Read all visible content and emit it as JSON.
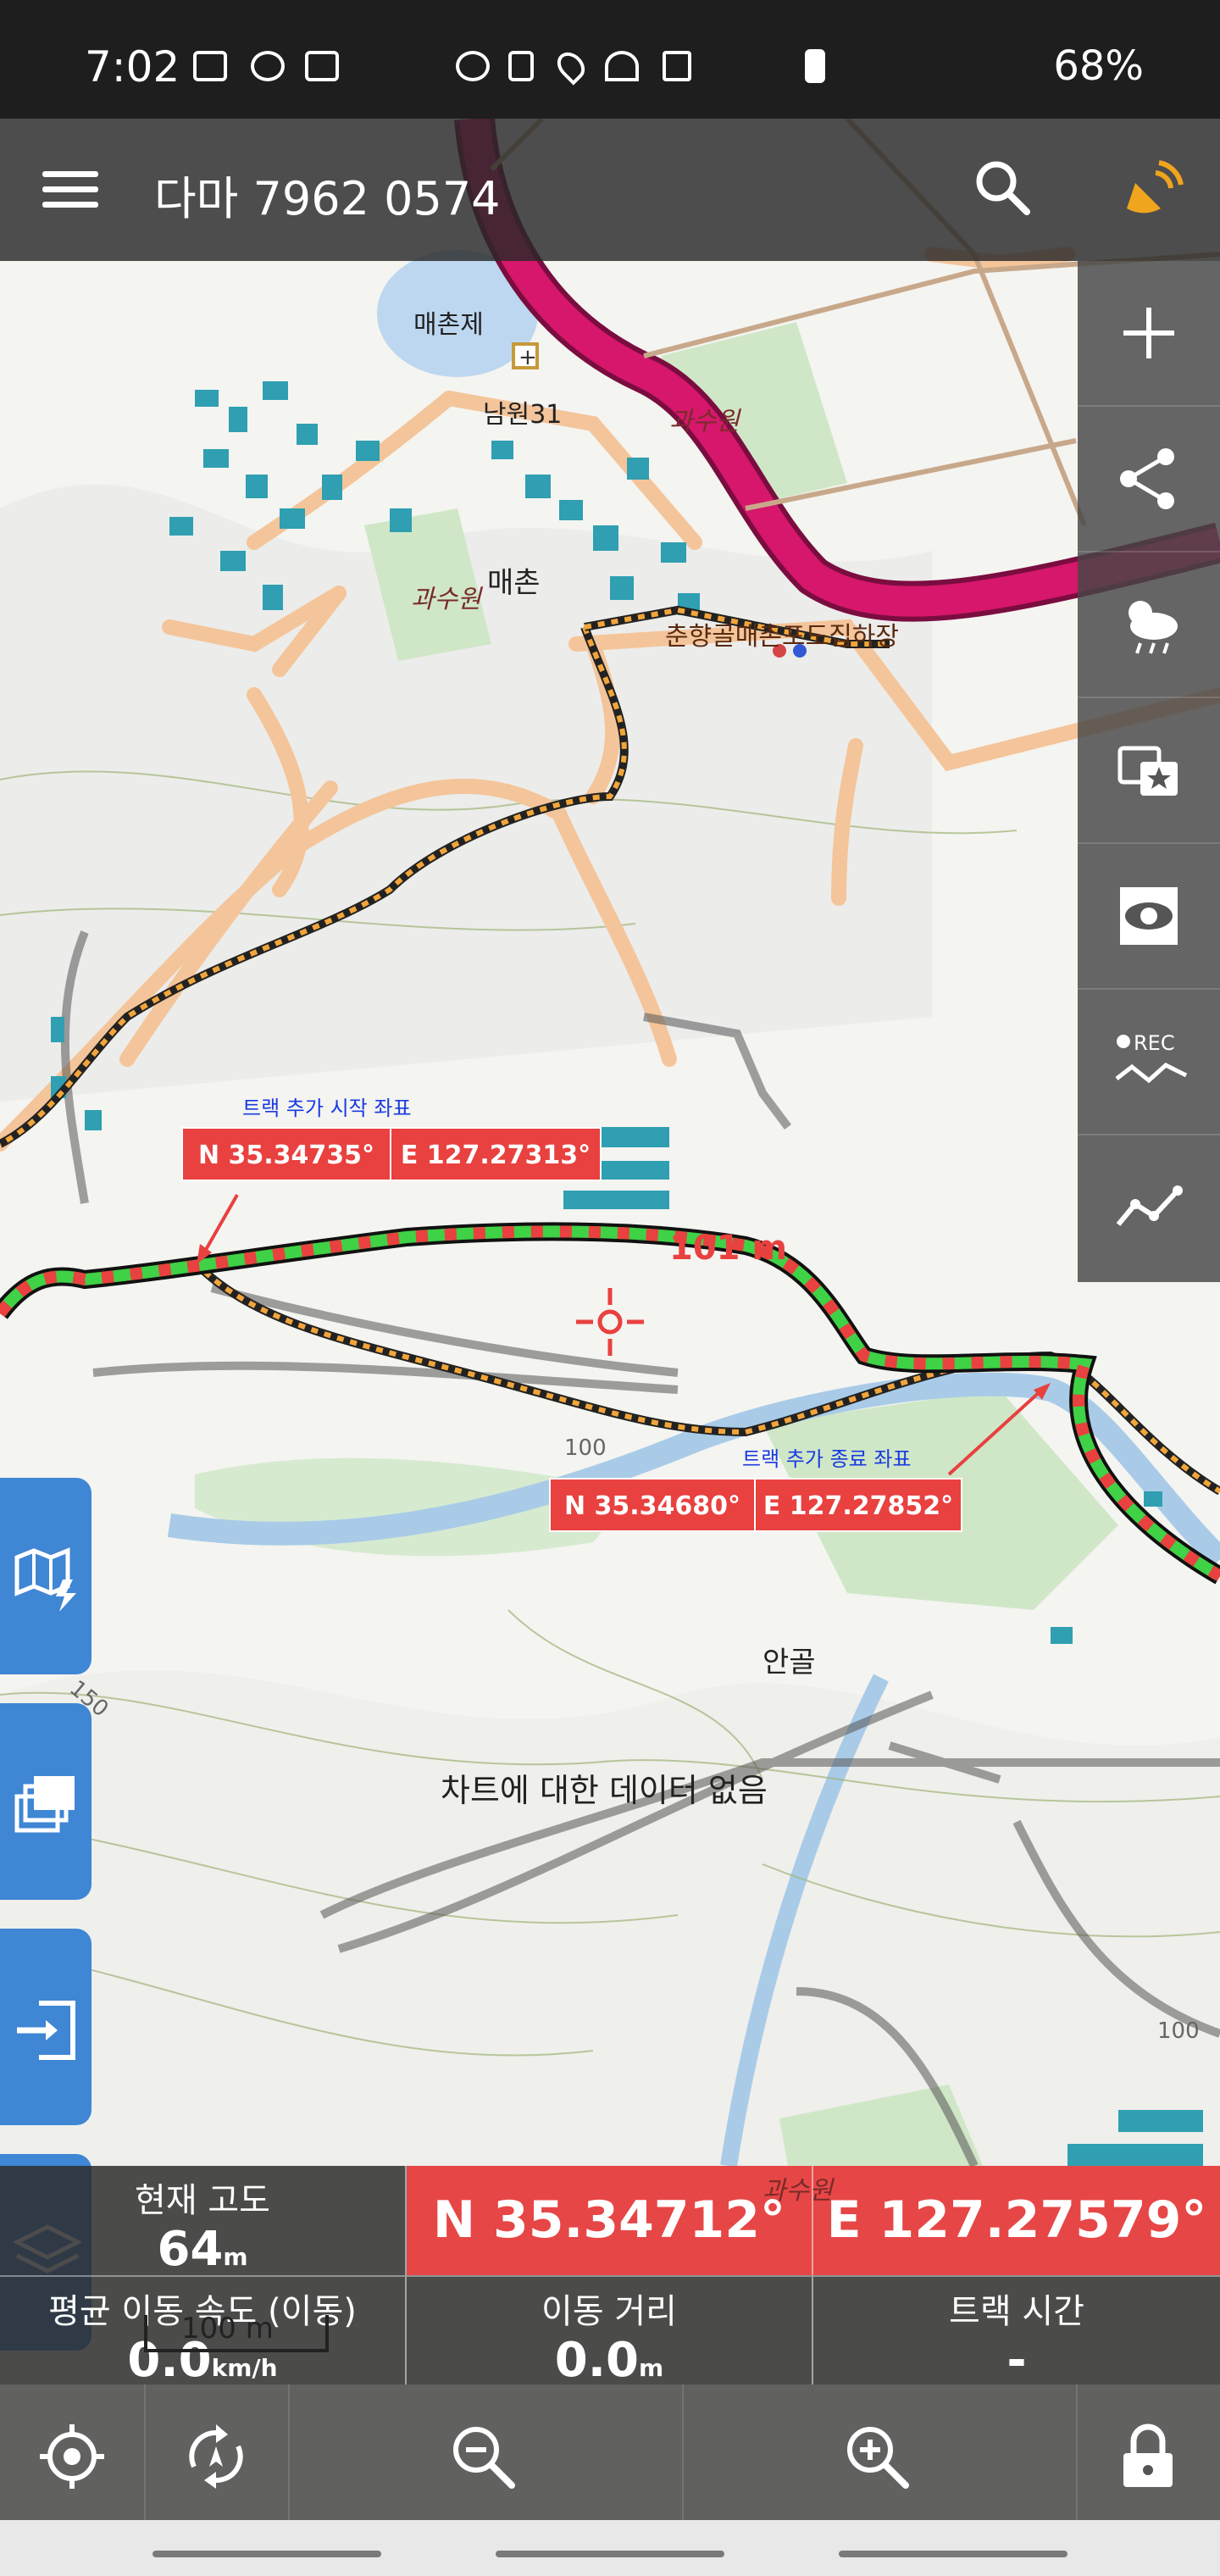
{
  "status_bar": {
    "time": "7:02",
    "battery": "68%"
  },
  "top_bar": {
    "title": "다마 7962 0574"
  },
  "map": {
    "place_labels": {
      "reservoir": "매촌제",
      "bus_stop": "남원31",
      "orchard_1": "과수원",
      "orchard_2": "과수원",
      "village": "매촌",
      "facility": "춘향골매촌포도집하장",
      "valley": "안골",
      "orchard_3": "과수원"
    },
    "contour_labels": {
      "c100a": "100",
      "c150": "150",
      "c100b": "100"
    },
    "track_start": {
      "caption": "트랙 추가 시작 좌표",
      "lat": "N 35.34735°",
      "lon": "E 127.27313°"
    },
    "track_end": {
      "caption": "트랙 추가 종료 좌표",
      "lat": "N 35.34680°",
      "lon": "E 127.27852°"
    },
    "distance_label": "101 m",
    "no_data": "차트에 대한 데이터 없음",
    "scale_bar": "100 m"
  },
  "info_panel": {
    "altitude_label": "현재 고도",
    "altitude_value": "64",
    "altitude_unit": "m",
    "lat": "N 35.34712°",
    "lon": "E 127.27579°",
    "speed_label": "평균 이동 속도 (이동)",
    "speed_value": "0.0",
    "speed_unit": "km/h",
    "distance_label": "이동 거리",
    "distance_value": "0.0",
    "distance_unit": "m",
    "track_time_label": "트랙 시간",
    "track_time_value": "-"
  },
  "icons": {
    "right_toolbar": [
      "plus-icon",
      "share-icon",
      "weather-icon",
      "favorite-icon",
      "visibility-icon",
      "rec-track-icon",
      "chart-icon"
    ],
    "left_buttons": [
      "map-mode-icon",
      "layers-stack-icon",
      "import-icon",
      "layers-icon"
    ],
    "bottom_toolbar": [
      "locate-icon",
      "rotate-icon",
      "zoom-out-icon",
      "zoom-in-icon",
      "lock-icon"
    ]
  },
  "colors": {
    "track_red": "#e8413f",
    "track_green": "#3fd146",
    "road_main": "#d6176b",
    "road_minor": "#f6c99a",
    "button_blue": "#3f86d4"
  },
  "rec_label": "REC"
}
